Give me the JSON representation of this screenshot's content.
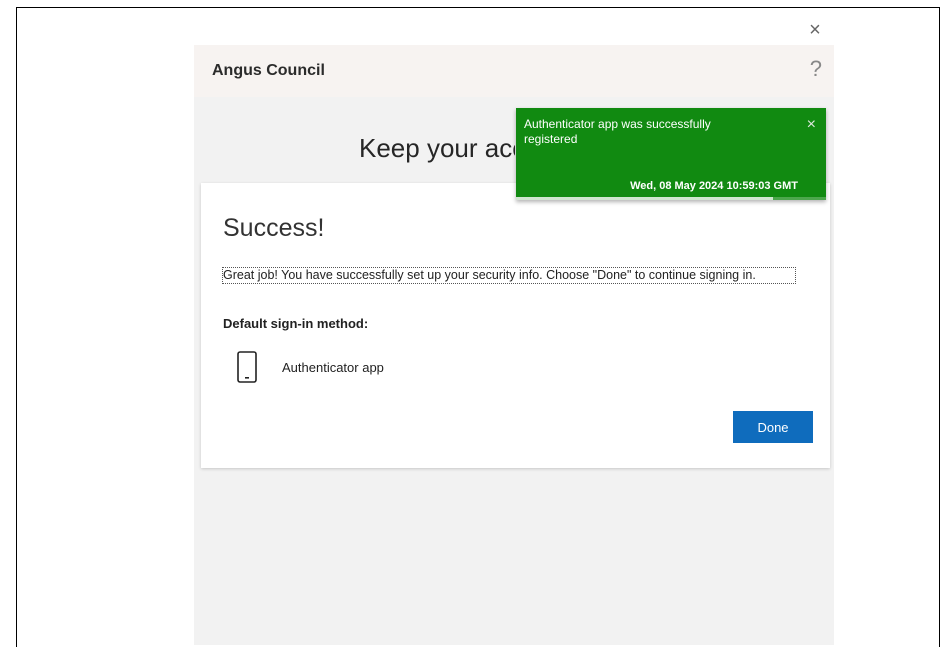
{
  "dialog": {
    "close_label": "×"
  },
  "header": {
    "org_name": "Angus Council",
    "help_label": "?"
  },
  "page": {
    "heading": "Keep your account secure"
  },
  "card": {
    "title": "Success!",
    "description": "Great job! You have successfully set up your security info. Choose \"Done\" to continue signing in.",
    "default_method_label": "Default sign-in method:",
    "method_name": "Authenticator app",
    "method_icon": "phone-icon",
    "done_label": "Done"
  },
  "toast": {
    "message": "Authenticator app was successfully registered",
    "timestamp": "Wed, 08 May 2024 10:59:03 GMT",
    "close_label": "×",
    "progress": 0.83
  },
  "colors": {
    "primary": "#0f6cbd",
    "toast_bg": "#118a11"
  }
}
